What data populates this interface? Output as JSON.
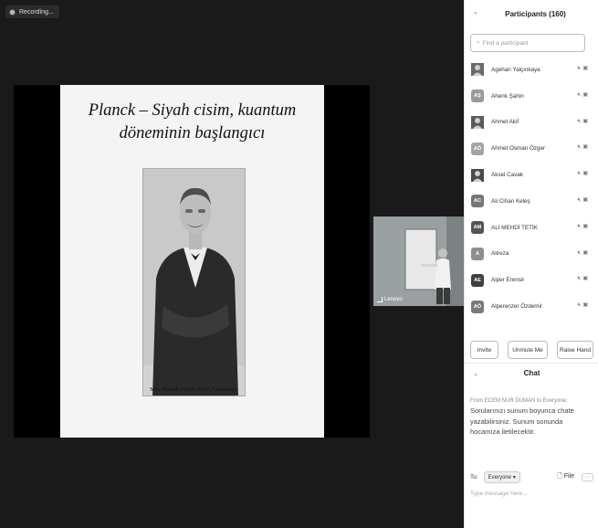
{
  "meeting": {
    "recording_label": "Recording...",
    "slide": {
      "title": "Planck – Siyah cisim, kuantum döneminin başlangıcı",
      "caption": "Max Planck (1858–1947, Germany)."
    },
    "video_name": "Lenovo"
  },
  "participants": {
    "title": "Participants (160)",
    "search_placeholder": "Find a participant",
    "list": [
      {
        "name": "Agehan Yalçınkaya",
        "initials": "",
        "color": "#6b6b6b",
        "photo": true
      },
      {
        "name": "Ahenk Şahin",
        "initials": "AŞ",
        "color": "#9a9a9a",
        "photo": false
      },
      {
        "name": "Ahmet Akif",
        "initials": "",
        "color": "#5b5b5b",
        "photo": true
      },
      {
        "name": "Ahmet Osman Özger",
        "initials": "AÖ",
        "color": "#a3a3a3",
        "photo": false
      },
      {
        "name": "Aksel Cavak",
        "initials": "",
        "color": "#4a4a4a",
        "photo": true
      },
      {
        "name": "Ali Cihan Keleş",
        "initials": "AC",
        "color": "#777777",
        "photo": false
      },
      {
        "name": "ALİ MEHDİ TETİK",
        "initials": "AM",
        "color": "#555555",
        "photo": false
      },
      {
        "name": "Alireza",
        "initials": "A",
        "color": "#8e8e8e",
        "photo": false
      },
      {
        "name": "Alper Erensir",
        "initials": "AE",
        "color": "#3f3f3f",
        "photo": false
      },
      {
        "name": "Alperenzer Özdemir",
        "initials": "AÖ",
        "color": "#7a7a7a",
        "photo": false
      }
    ],
    "buttons": {
      "invite": "Invite",
      "unmute": "Unmute Me",
      "raise_hand": "Raise Hand"
    }
  },
  "chat": {
    "title": "Chat",
    "from": "From ECEM NUR DUMAN to Everyone:",
    "message": "Sorularınızı sunum boyunca chate yazabilirsiniz. Sunum sonunda hocamıza iletilecektir.",
    "to_label": "To:",
    "recipient": "Everyone",
    "file_label": "File",
    "more_label": "···",
    "input_placeholder": "Type message here..."
  }
}
